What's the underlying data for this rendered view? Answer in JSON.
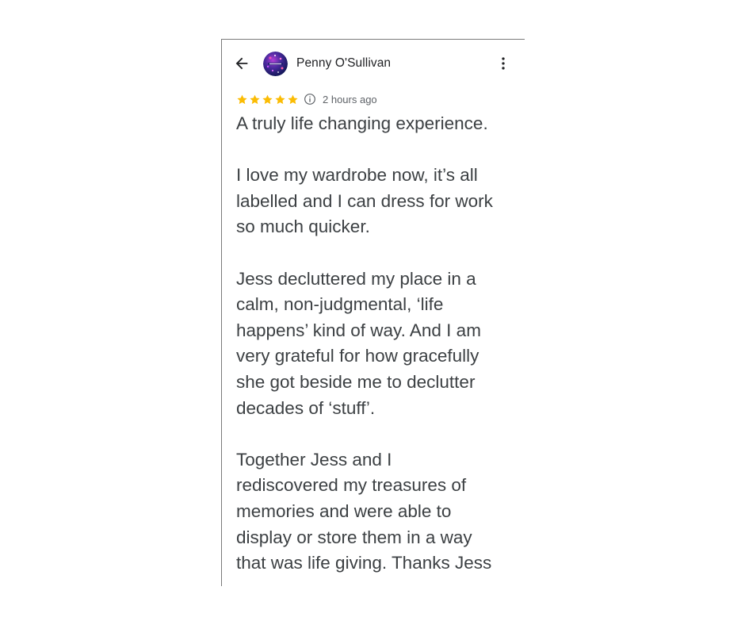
{
  "review": {
    "reviewer_name": "Penny O'Sullivan",
    "rating": 5,
    "max_rating": 5,
    "time_ago": "2 hours ago",
    "paragraphs": [
      [
        "A truly life changing experience."
      ],
      [
        "I love my wardrobe now, it’s all",
        "labelled and I can dress for work",
        "so much quicker."
      ],
      [
        "Jess decluttered my place in a",
        "calm, non-judgmental, ‘life",
        "happens’ kind of way. And I am",
        "very grateful for how gracefully",
        "she got beside me to declutter",
        "decades of ‘stuff’."
      ],
      [
        "Together Jess and I",
        "rediscovered my treasures of",
        "memories and were able to",
        "display or store them in a way",
        "that was life giving. Thanks Jess"
      ]
    ]
  },
  "colors": {
    "star": "#fbbc04",
    "text_primary": "#202124",
    "text_body": "#3c4043",
    "text_secondary": "#5f6368"
  },
  "icons": {
    "back": "back-arrow-icon",
    "more": "more-vert-icon",
    "info": "info-icon",
    "star": "star-icon"
  }
}
